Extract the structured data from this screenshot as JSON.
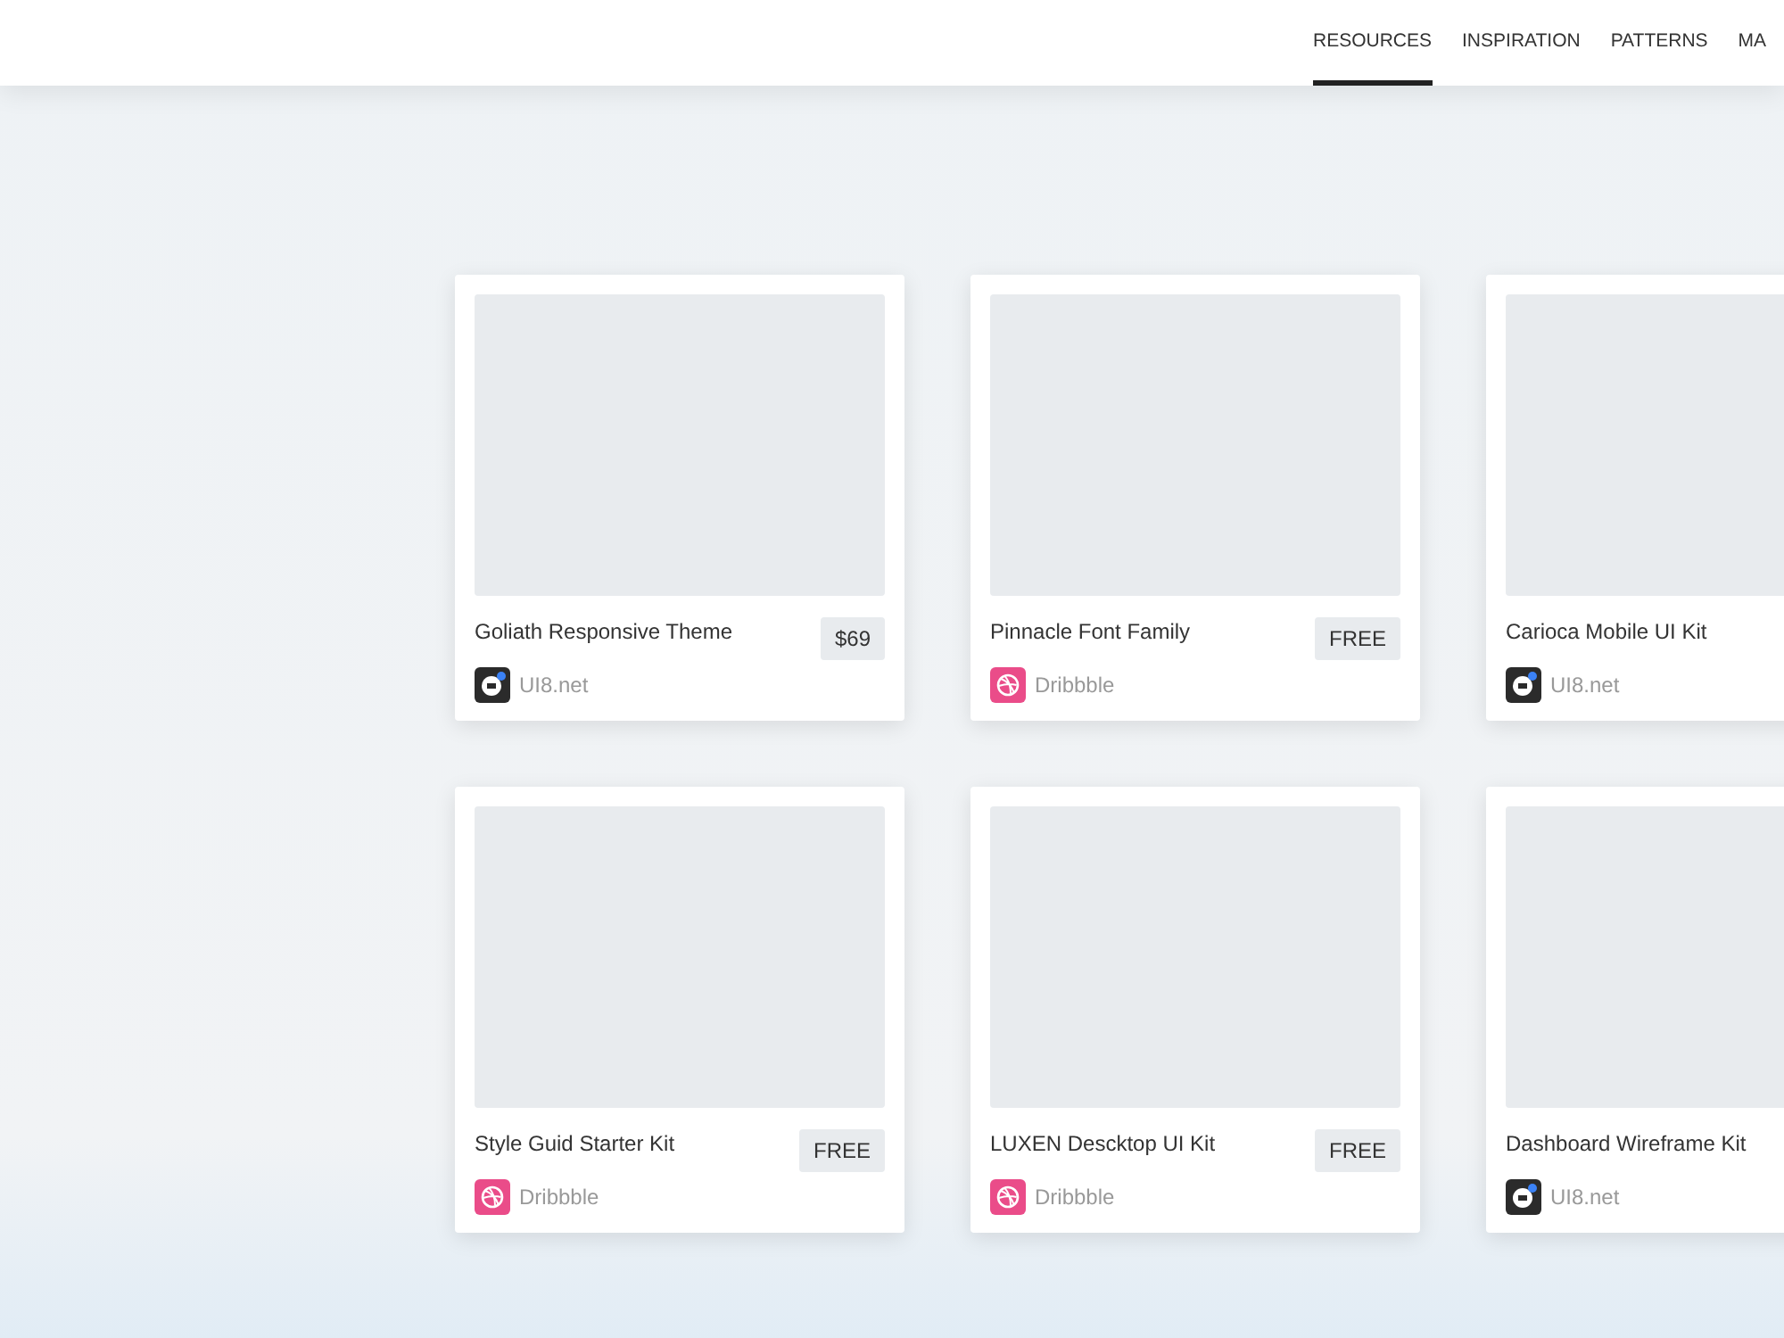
{
  "nav": [
    {
      "label": "RESOURCES",
      "selected": true
    },
    {
      "label": "INSPIRATION",
      "selected": false
    },
    {
      "label": "PATTERNS",
      "selected": false
    },
    {
      "label": "MA",
      "selected": false
    }
  ],
  "cards": [
    {
      "title": "Goliath Responsive Theme",
      "price": "$69",
      "source": "UI8.net",
      "kind": "ui8"
    },
    {
      "title": "Pinnacle Font Family",
      "price": "FREE",
      "source": "Dribbble",
      "kind": "dribbble"
    },
    {
      "title": "Carioca Mobile UI Kit",
      "source": "UI8.net",
      "kind": "ui8"
    },
    {
      "title": "Style Guid Starter Kit",
      "price": "FREE",
      "source": "Dribbble",
      "kind": "dribbble"
    },
    {
      "title": "LUXEN Descktop UI Kit",
      "price": "FREE",
      "source": "Dribbble",
      "kind": "dribbble"
    },
    {
      "title": "Dashboard Wireframe Kit",
      "source": "UI8.net",
      "kind": "ui8"
    }
  ]
}
